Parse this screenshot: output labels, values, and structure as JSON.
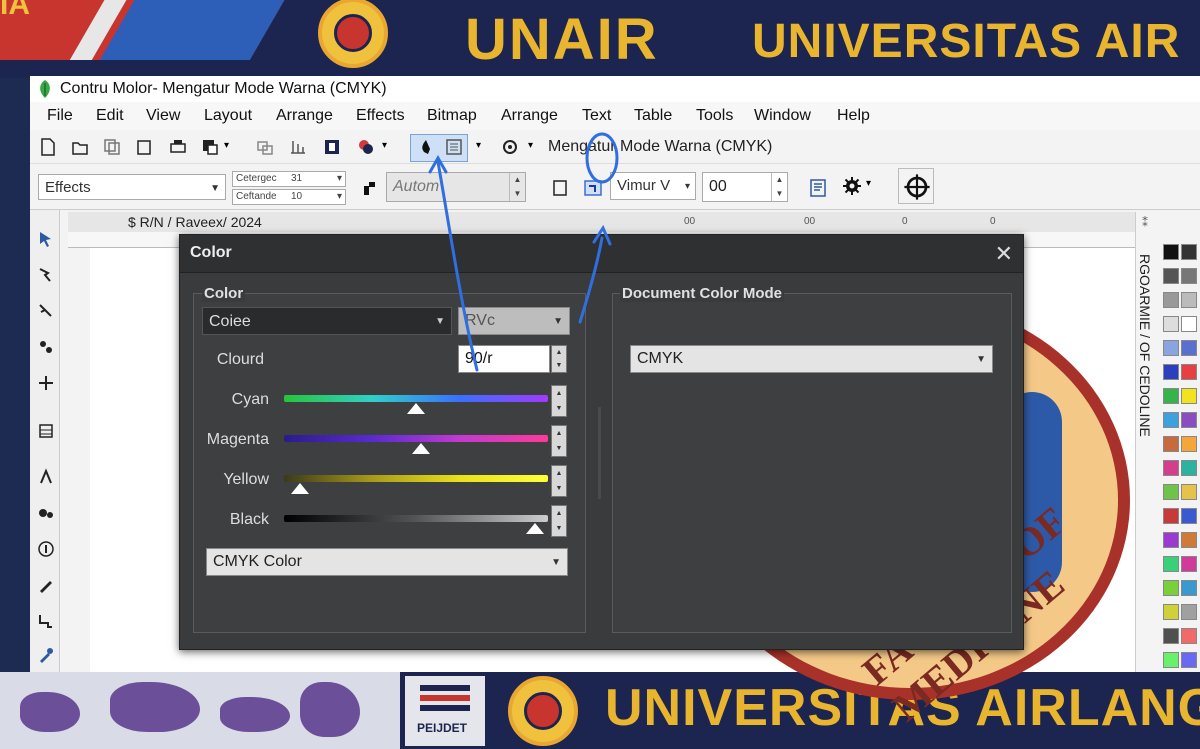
{
  "banner": {
    "left_text": "IA",
    "title_short": "UNAIR",
    "title_long": "UNIVERSITAS AIR",
    "bottom_badge_label": "PEIJDET",
    "bottom_title": "UNIVERSITAS AIRLANG"
  },
  "seal_text": "FACULTY OF MEDICINE",
  "app": {
    "title": "Contru Molor- Mengatur Mode Warna (CMYK)",
    "menu": [
      "File",
      "Edit",
      "View",
      "Layout",
      "Arrange",
      "Effects",
      "Bitmap",
      "Arrange",
      "Text",
      "Table",
      "Tools",
      "Window",
      "Help"
    ],
    "toolbar_title": "Mengatur Mode Warna (CMYK)",
    "effects_combo": "Effects",
    "small_field_1_label": "Cetergec",
    "small_field_1_value": "31",
    "small_field_2_label": "Ceftande",
    "small_field_2_value": "10",
    "font_field": "Autom",
    "vimur_combo": "Vimur V",
    "number_field": "00",
    "doc_tab": "$ R/N / Raveex/ 2024",
    "ruler_labels": [
      "00",
      "00",
      "0",
      "0"
    ],
    "docker_text": "RGOARMIE / OF CEDOLINE"
  },
  "palette_colors": [
    "#111111",
    "#333333",
    "#555555",
    "#777777",
    "#999999",
    "#bbbbbb",
    "#dddddd",
    "#ffffff",
    "#8aa4e0",
    "#5a6fd0",
    "#2c3fbf",
    "#e64040",
    "#38b24a",
    "#f2e21f",
    "#3ea0dd",
    "#8a4cc0",
    "#c86a40",
    "#f4a63a",
    "#d43f8d",
    "#2bb3a0",
    "#6fc24a",
    "#e6c24a",
    "#c83a3a",
    "#3a5ad0",
    "#9a3ad0",
    "#d07a3a",
    "#3ad07a",
    "#d03a9a",
    "#7ad03a",
    "#3a9ad0",
    "#d0d03a",
    "#a0a0a0",
    "#505050",
    "#f06a6a",
    "#6af06a",
    "#6a6af0"
  ],
  "dialog": {
    "title": "Color",
    "close": "✕",
    "left_group_label": "Color",
    "color_combo": "Coiee",
    "model_combo": "RVc",
    "count_label": "Clourd",
    "count_value": "90/r",
    "channels": [
      {
        "label": "Cyan",
        "value": 0.5
      },
      {
        "label": "Magenta",
        "value": 0.52
      },
      {
        "label": "Yellow",
        "value": 0.06
      },
      {
        "label": "Black",
        "value": 0.95
      }
    ],
    "mode_combo": "CMYK Color",
    "right_group_label": "Document Color Mode",
    "doc_mode_combo": "CMYK"
  },
  "colors": {
    "banner_navy": "#1b2550",
    "banner_gold": "#e9b52f",
    "dialog_bg": "#3a3b3c",
    "annotation_blue": "#2f6fe0"
  }
}
